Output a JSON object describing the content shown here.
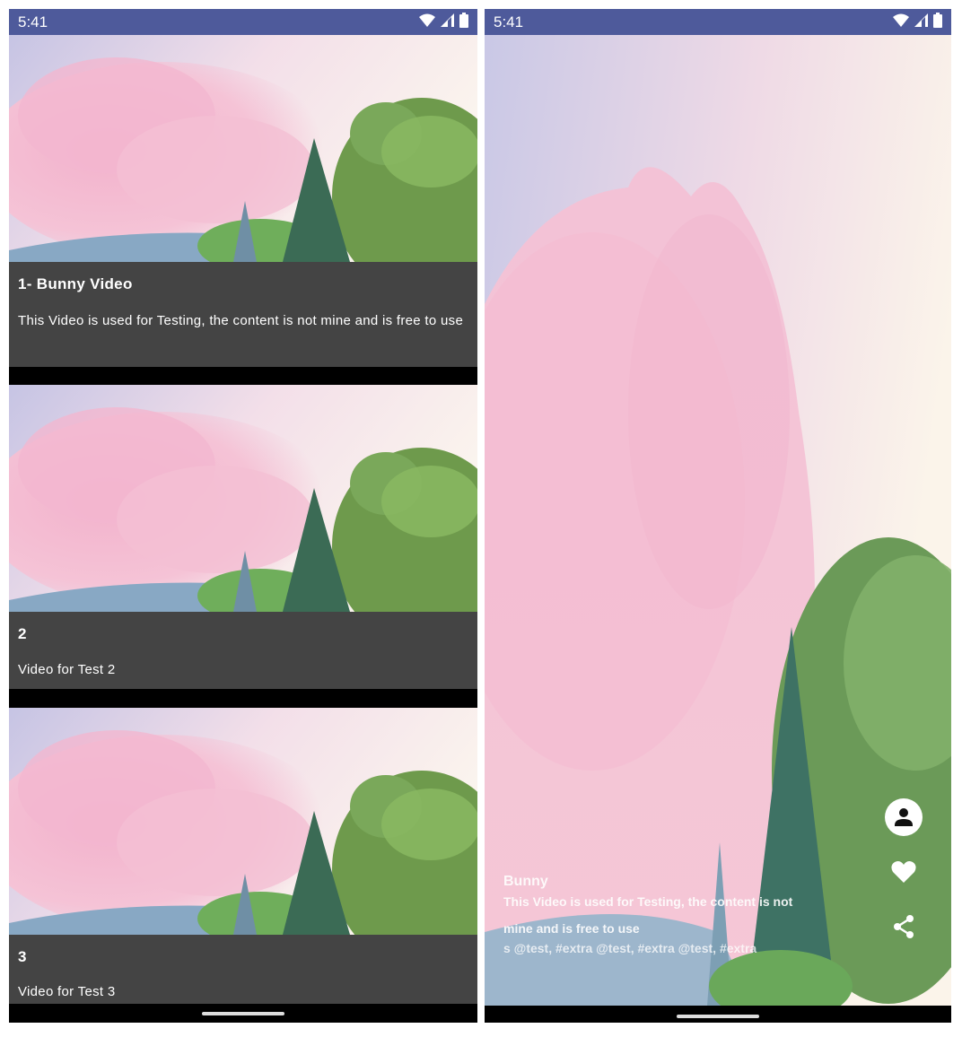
{
  "status_bar": {
    "time": "5:41"
  },
  "feed": {
    "items": [
      {
        "title": "1- Bunny Video",
        "description": "This Video is used for Testing, the content is not mine and is free to use"
      },
      {
        "title": "2",
        "description": "Video for Test 2"
      },
      {
        "title": "3",
        "description": "Video for Test 3"
      }
    ]
  },
  "player": {
    "title": "Bunny",
    "description_line1": "This Video is used for Testing, the content is not",
    "description_line2": "mine and is free to use",
    "tags": "s @test, #extra @test, #extra @test, #extra"
  },
  "icons": {
    "status": [
      "wifi-icon",
      "cell-signal-icon",
      "battery-icon"
    ],
    "actions": [
      "profile-icon",
      "heart-icon",
      "share-icon"
    ]
  },
  "colors": {
    "status_bar": "#4e5a9b",
    "info_panel": "#444444"
  }
}
